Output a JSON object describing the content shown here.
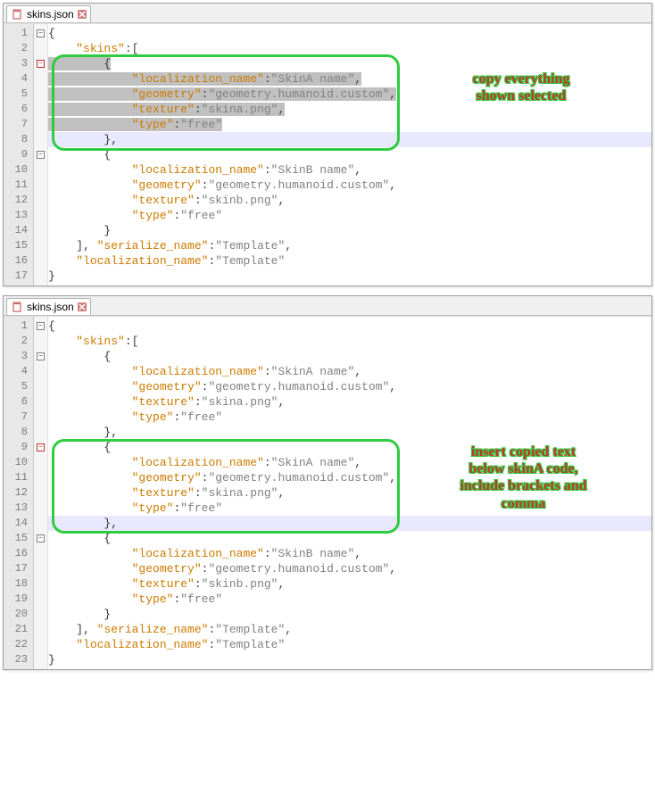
{
  "tabTitle": "skins.json",
  "annotations": {
    "top": "copy everything\nshown selected",
    "bottom": "insert copied text\nbelow skinA code,\ninclude brackets and\ncomma"
  },
  "editor1": {
    "lineCount": 17,
    "lines": [
      {
        "indent": 0,
        "tokens": [
          [
            "b",
            "{"
          ]
        ]
      },
      {
        "indent": 1,
        "tokens": [
          [
            "k",
            "\"skins\""
          ],
          [
            "p",
            ":["
          ]
        ]
      },
      {
        "indent": 2,
        "tokens": [
          [
            "b",
            "{"
          ]
        ],
        "selStart": true
      },
      {
        "indent": 3,
        "tokens": [
          [
            "k",
            "\"localization_name\""
          ],
          [
            "p",
            ":"
          ],
          [
            "s",
            "\"SkinA name\""
          ],
          [
            "p",
            ","
          ]
        ],
        "sel": true
      },
      {
        "indent": 3,
        "tokens": [
          [
            "k",
            "\"geometry\""
          ],
          [
            "p",
            ":"
          ],
          [
            "s",
            "\"geometry.humanoid.custom\""
          ],
          [
            "p",
            ","
          ]
        ],
        "sel": true
      },
      {
        "indent": 3,
        "tokens": [
          [
            "k",
            "\"texture\""
          ],
          [
            "p",
            ":"
          ],
          [
            "s",
            "\"skina.png\""
          ],
          [
            "p",
            ","
          ]
        ],
        "sel": true
      },
      {
        "indent": 3,
        "tokens": [
          [
            "k",
            "\"type\""
          ],
          [
            "p",
            ":"
          ],
          [
            "s",
            "\"free\""
          ]
        ],
        "sel": true
      },
      {
        "indent": 2,
        "tokens": [
          [
            "b",
            "},"
          ]
        ],
        "hl": true
      },
      {
        "indent": 2,
        "tokens": [
          [
            "b",
            "{"
          ]
        ]
      },
      {
        "indent": 3,
        "tokens": [
          [
            "k",
            "\"localization_name\""
          ],
          [
            "p",
            ":"
          ],
          [
            "s",
            "\"SkinB name\""
          ],
          [
            "p",
            ","
          ]
        ]
      },
      {
        "indent": 3,
        "tokens": [
          [
            "k",
            "\"geometry\""
          ],
          [
            "p",
            ":"
          ],
          [
            "s",
            "\"geometry.humanoid.custom\""
          ],
          [
            "p",
            ","
          ]
        ]
      },
      {
        "indent": 3,
        "tokens": [
          [
            "k",
            "\"texture\""
          ],
          [
            "p",
            ":"
          ],
          [
            "s",
            "\"skinb.png\""
          ],
          [
            "p",
            ","
          ]
        ]
      },
      {
        "indent": 3,
        "tokens": [
          [
            "k",
            "\"type\""
          ],
          [
            "p",
            ":"
          ],
          [
            "s",
            "\"free\""
          ]
        ]
      },
      {
        "indent": 2,
        "tokens": [
          [
            "b",
            "}"
          ]
        ]
      },
      {
        "indent": 1,
        "tokens": [
          [
            "p",
            "], "
          ],
          [
            "k",
            "\"serialize_name\""
          ],
          [
            "p",
            ":"
          ],
          [
            "s",
            "\"Template\""
          ],
          [
            "p",
            ","
          ]
        ]
      },
      {
        "indent": 1,
        "tokens": [
          [
            "k",
            "\"localization_name\""
          ],
          [
            "p",
            ":"
          ],
          [
            "s",
            "\"Template\""
          ]
        ]
      },
      {
        "indent": 0,
        "tokens": [
          [
            "b",
            "}"
          ]
        ]
      }
    ],
    "fold": [
      "box",
      "",
      "boxred",
      "",
      "",
      "",
      "",
      "",
      "box",
      "",
      "",
      "",
      "",
      "",
      "",
      "",
      ""
    ]
  },
  "editor2": {
    "lineCount": 23,
    "lines": [
      {
        "indent": 0,
        "tokens": [
          [
            "b",
            "{"
          ]
        ]
      },
      {
        "indent": 1,
        "tokens": [
          [
            "k",
            "\"skins\""
          ],
          [
            "p",
            ":["
          ]
        ]
      },
      {
        "indent": 2,
        "tokens": [
          [
            "b",
            "{"
          ]
        ]
      },
      {
        "indent": 3,
        "tokens": [
          [
            "k",
            "\"localization_name\""
          ],
          [
            "p",
            ":"
          ],
          [
            "s",
            "\"SkinA name\""
          ],
          [
            "p",
            ","
          ]
        ]
      },
      {
        "indent": 3,
        "tokens": [
          [
            "k",
            "\"geometry\""
          ],
          [
            "p",
            ":"
          ],
          [
            "s",
            "\"geometry.humanoid.custom\""
          ],
          [
            "p",
            ","
          ]
        ]
      },
      {
        "indent": 3,
        "tokens": [
          [
            "k",
            "\"texture\""
          ],
          [
            "p",
            ":"
          ],
          [
            "s",
            "\"skina.png\""
          ],
          [
            "p",
            ","
          ]
        ]
      },
      {
        "indent": 3,
        "tokens": [
          [
            "k",
            "\"type\""
          ],
          [
            "p",
            ":"
          ],
          [
            "s",
            "\"free\""
          ]
        ]
      },
      {
        "indent": 2,
        "tokens": [
          [
            "b",
            "},"
          ]
        ]
      },
      {
        "indent": 2,
        "tokens": [
          [
            "b",
            "{"
          ]
        ]
      },
      {
        "indent": 3,
        "tokens": [
          [
            "k",
            "\"localization_name\""
          ],
          [
            "p",
            ":"
          ],
          [
            "s",
            "\"SkinA name\""
          ],
          [
            "p",
            ","
          ]
        ]
      },
      {
        "indent": 3,
        "tokens": [
          [
            "k",
            "\"geometry\""
          ],
          [
            "p",
            ":"
          ],
          [
            "s",
            "\"geometry.humanoid.custom\""
          ],
          [
            "p",
            ","
          ]
        ]
      },
      {
        "indent": 3,
        "tokens": [
          [
            "k",
            "\"texture\""
          ],
          [
            "p",
            ":"
          ],
          [
            "s",
            "\"skina.png\""
          ],
          [
            "p",
            ","
          ]
        ]
      },
      {
        "indent": 3,
        "tokens": [
          [
            "k",
            "\"type\""
          ],
          [
            "p",
            ":"
          ],
          [
            "s",
            "\"free\""
          ]
        ]
      },
      {
        "indent": 2,
        "tokens": [
          [
            "b",
            "},"
          ]
        ],
        "hl": true
      },
      {
        "indent": 2,
        "tokens": [
          [
            "b",
            "{"
          ]
        ]
      },
      {
        "indent": 3,
        "tokens": [
          [
            "k",
            "\"localization_name\""
          ],
          [
            "p",
            ":"
          ],
          [
            "s",
            "\"SkinB name\""
          ],
          [
            "p",
            ","
          ]
        ]
      },
      {
        "indent": 3,
        "tokens": [
          [
            "k",
            "\"geometry\""
          ],
          [
            "p",
            ":"
          ],
          [
            "s",
            "\"geometry.humanoid.custom\""
          ],
          [
            "p",
            ","
          ]
        ]
      },
      {
        "indent": 3,
        "tokens": [
          [
            "k",
            "\"texture\""
          ],
          [
            "p",
            ":"
          ],
          [
            "s",
            "\"skinb.png\""
          ],
          [
            "p",
            ","
          ]
        ]
      },
      {
        "indent": 3,
        "tokens": [
          [
            "k",
            "\"type\""
          ],
          [
            "p",
            ":"
          ],
          [
            "s",
            "\"free\""
          ]
        ]
      },
      {
        "indent": 2,
        "tokens": [
          [
            "b",
            "}"
          ]
        ]
      },
      {
        "indent": 1,
        "tokens": [
          [
            "p",
            "], "
          ],
          [
            "k",
            "\"serialize_name\""
          ],
          [
            "p",
            ":"
          ],
          [
            "s",
            "\"Template\""
          ],
          [
            "p",
            ","
          ]
        ]
      },
      {
        "indent": 1,
        "tokens": [
          [
            "k",
            "\"localization_name\""
          ],
          [
            "p",
            ":"
          ],
          [
            "s",
            "\"Template\""
          ]
        ]
      },
      {
        "indent": 0,
        "tokens": [
          [
            "b",
            "}"
          ]
        ]
      }
    ],
    "fold": [
      "box",
      "",
      "box",
      "",
      "",
      "",
      "",
      "",
      "boxred",
      "",
      "",
      "",
      "",
      "",
      "box",
      "",
      "",
      "",
      "",
      "",
      "",
      "",
      ""
    ]
  }
}
